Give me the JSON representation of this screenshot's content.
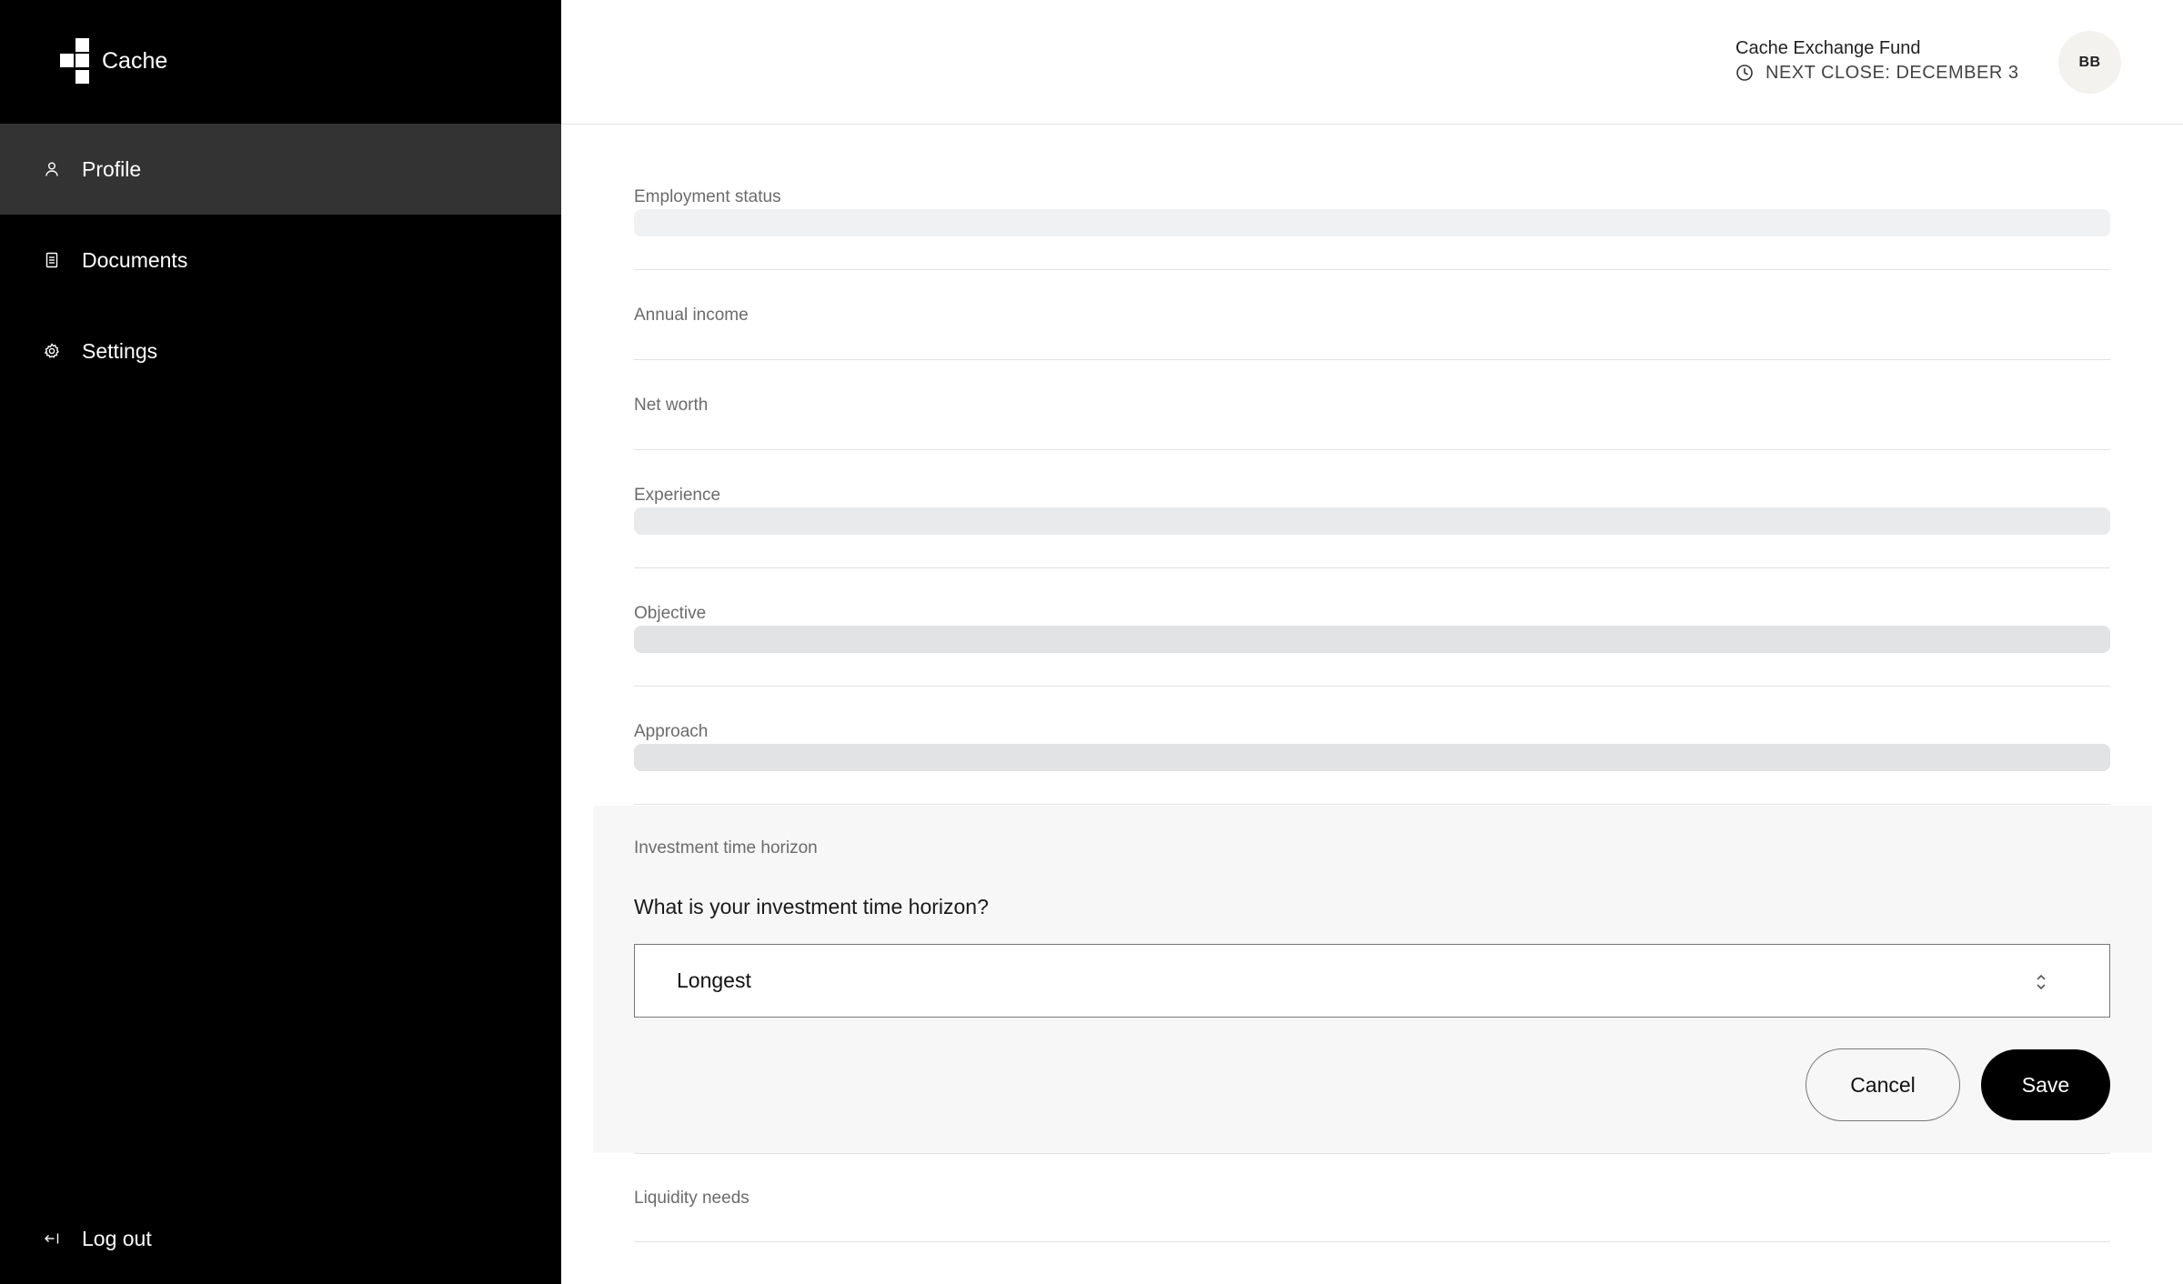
{
  "brand": {
    "name": "Cache"
  },
  "sidebar": {
    "items": [
      {
        "label": "Profile",
        "icon": "user-icon",
        "active": true
      },
      {
        "label": "Documents",
        "icon": "document-icon",
        "active": false
      },
      {
        "label": "Settings",
        "icon": "gear-icon",
        "active": false
      }
    ],
    "logout_label": "Log out"
  },
  "header": {
    "fund_name": "Cache Exchange Fund",
    "next_close": "NEXT CLOSE: DECEMBER 3",
    "avatar_initials": "BB"
  },
  "fields": [
    {
      "label": "Employment status"
    },
    {
      "label": "Annual income"
    },
    {
      "label": "Net worth"
    },
    {
      "label": "Experience"
    },
    {
      "label": "Objective"
    },
    {
      "label": "Approach"
    }
  ],
  "editor": {
    "label": "Investment time horizon",
    "question": "What is your investment time horizon?",
    "selected_value": "Longest",
    "cancel_label": "Cancel",
    "save_label": "Save"
  },
  "after_fields": [
    {
      "label": "Liquidity needs"
    }
  ],
  "colors": {
    "sidebar_bg": "#000000",
    "sidebar_active": "#333333",
    "editor_bg": "#f7f7f7",
    "primary_button": "#000000"
  }
}
